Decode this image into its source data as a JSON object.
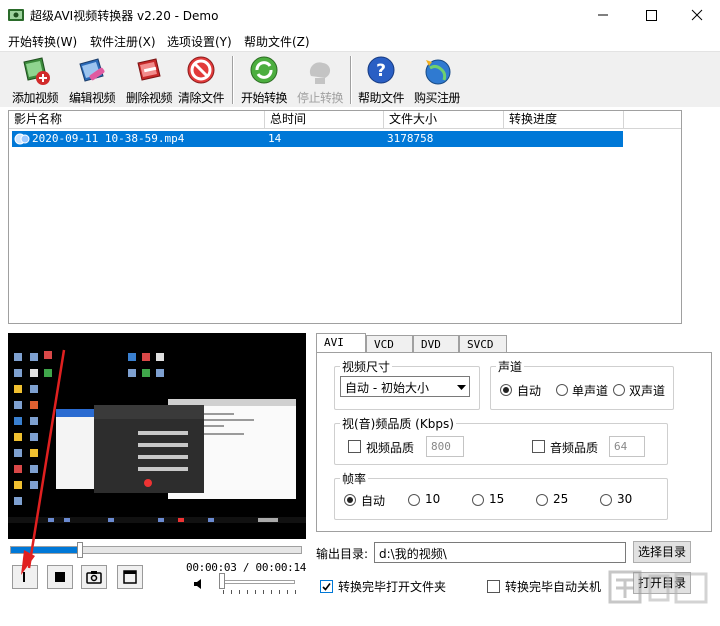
{
  "window": {
    "title": "超级AVI视频转换器 v2.20 - Demo",
    "controls": [
      "minimize",
      "maximize",
      "close"
    ]
  },
  "menu": [
    "开始转换(W)",
    "软件注册(X)",
    "选项设置(Y)",
    "帮助文件(Z)"
  ],
  "toolbar": [
    {
      "label": "添加视频",
      "icon": "add-video-icon",
      "enabled": true
    },
    {
      "label": "编辑视频",
      "icon": "edit-video-icon",
      "enabled": true
    },
    {
      "label": "删除视频",
      "icon": "delete-video-icon",
      "enabled": true
    },
    {
      "label": "清除文件",
      "icon": "clear-icon",
      "enabled": true
    },
    {
      "label": "开始转换",
      "icon": "start-convert-icon",
      "enabled": true
    },
    {
      "label": "停止转换",
      "icon": "stop-convert-icon",
      "enabled": false
    },
    {
      "label": "帮助文件",
      "icon": "help-icon",
      "enabled": true
    },
    {
      "label": "购买注册",
      "icon": "buy-register-icon",
      "enabled": true
    }
  ],
  "file_list": {
    "columns": [
      "影片名称",
      "总时间",
      "文件大小",
      "转换进度"
    ],
    "rows": [
      {
        "name": "2020-09-11 10-38-59.mp4",
        "duration": "14",
        "size": "3178758",
        "progress": ""
      }
    ]
  },
  "player": {
    "time": "00:00:03 / 00:00:14",
    "progress_fraction": 0.24,
    "volume_fraction": 0.0,
    "buttons": [
      "pause",
      "stop",
      "snapshot",
      "fullscreen"
    ]
  },
  "tabs": {
    "items": [
      "AVI",
      "VCD",
      "DVD",
      "SVCD"
    ],
    "active": "AVI"
  },
  "settings": {
    "video_size": {
      "label": "视频尺寸",
      "value": "自动 - 初始大小"
    },
    "channel": {
      "label": "声道",
      "options": [
        "自动",
        "单声道",
        "双声道"
      ],
      "selected": "自动"
    },
    "quality": {
      "label": "视(音)频品质 (Kbps)",
      "video_label": "视频品质",
      "video_value": "800",
      "video_checked": false,
      "audio_label": "音频品质",
      "audio_value": "64",
      "audio_checked": false
    },
    "framerate": {
      "label": "帧率",
      "options": [
        "自动",
        "10",
        "15",
        "25",
        "30"
      ],
      "selected": "自动"
    }
  },
  "output": {
    "label": "输出目录:",
    "value": "d:\\我的视频\\",
    "choose_button": "选择目录",
    "open_button": "打开目录"
  },
  "options": {
    "open_after": {
      "label": "转换完毕打开文件夹",
      "checked": true
    },
    "shutdown_after": {
      "label": "转换完毕自动关机",
      "checked": false
    }
  },
  "colors": {
    "selection": "#0078d7",
    "annotation_arrow": "#e02020",
    "toolbar_bg": "#f0f0f0"
  }
}
